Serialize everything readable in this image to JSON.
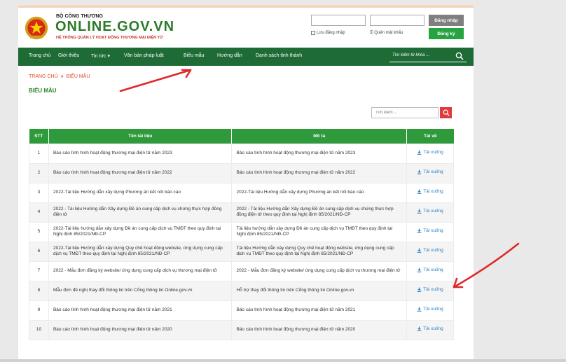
{
  "header": {
    "ministry": "BỘ CÔNG THƯƠNG",
    "brand": "ONLINE.GOV.VN",
    "subtitle": "HỆ THỐNG QUẢN LÝ HOẠT ĐỘNG THƯƠNG MẠI ĐIỆN TỬ",
    "login_button": "Đăng nhập",
    "register_button": "Đăng ký",
    "remember_label": "Lưu đăng nhập",
    "forgot_label": "Quên mật khẩu",
    "forgot_icon": "key-icon"
  },
  "nav": {
    "items": [
      "Trang chủ",
      "Giới thiệu",
      "Tin tức ▾",
      "Văn bản pháp luật",
      "Biểu mẫu",
      "Hướng dẫn",
      "Danh sách tỉnh thành"
    ],
    "search_placeholder": "Tìm kiếm từ khóa ...",
    "bg_color": "#1e6b36"
  },
  "breadcrumb": {
    "home": "TRANG CHỦ",
    "separator": "»",
    "current": "BIỂU MẪU"
  },
  "page_title": "BIỂU MẪU",
  "search": {
    "placeholder": "Tìm kiếm ..."
  },
  "table": {
    "headers": [
      "STT",
      "Tên tài liệu",
      "Mô tả",
      "Tải về"
    ],
    "download_label": "Tải xuống",
    "rows": [
      {
        "stt": "1",
        "name": "Báo cáo tình hình hoạt động thương mại điện tử năm 2023",
        "desc": "Báo cáo tình hình hoạt động thương mại điện tử năm 2023"
      },
      {
        "stt": "2",
        "name": "Báo cáo tình hình hoạt động thương mại điện tử năm 2022",
        "desc": "Báo cáo tình hình hoạt động thương mại điện tử năm 2022"
      },
      {
        "stt": "3",
        "name": "2022-Tài liệu Hướng dẫn xây dựng Phương án kết nối báo cáo",
        "desc": "2022-Tài liệu Hướng dẫn xây dựng Phương án kết nối báo cáo"
      },
      {
        "stt": "4",
        "name": "2022 - Tài liệu Hướng dẫn Xây dựng Đề án cung cấp dịch vụ chứng thực hợp đồng điện tử",
        "desc": "2022 - Tài liệu Hướng dẫn Xây dựng Đề án cung cấp dịch vụ chứng thực hợp đồng điện tử theo quy định tại Nghị định 85/2021/NĐ-CP"
      },
      {
        "stt": "5",
        "name": "2022-Tài liệu hướng dẫn xây dựng Đề án cung cấp dịch vụ TMĐT theo quy định tại Nghị định 85/2021/NĐ-CP",
        "desc": "Tài liệu hướng dẫn xây dựng Đề án cung cấp dịch vụ TMĐT theo quy định tại Nghị định 85/2021/NĐ-CP"
      },
      {
        "stt": "6",
        "name": "2022-Tài liệu Hướng dẫn xây dựng Quy chế hoạt động website, ứng dụng cung cấp dịch vụ TMĐT theo quy định tại Nghị định 85/2021/NĐ-CP",
        "desc": "Tài liệu Hướng dẫn xây dựng Quy chế hoạt động website, ứng dụng cung cấp dịch vụ TMĐT theo quy định tại Nghị định 85/2021/NĐ-CP"
      },
      {
        "stt": "7",
        "name": "2022 - Mẫu đơn đăng ký website/ ứng dụng cung cấp dịch vụ thương mại điện tử",
        "desc": "2022 - Mẫu đơn đăng ký website/ ứng dụng cung cấp dịch vụ thương mại điện tử"
      },
      {
        "stt": "8",
        "name": "Mẫu đơn đề nghị thay đổi thông tin trên Cổng thông tin Online.gov.vn",
        "desc": "Hỗ trợ thay đổi thông tin trên Cổng thông tin Online.gov.vn"
      },
      {
        "stt": "9",
        "name": "Báo cáo tình hình hoạt động thương mại điện tử năm 2021",
        "desc": "Báo cáo tình hình hoạt động thương mại điện tử năm 2021"
      },
      {
        "stt": "10",
        "name": "Báo cáo tình hình hoạt động thương mại điện tử năm 2020",
        "desc": "Báo cáo tình hình hoạt động thương mại điện tử năm 2020"
      }
    ]
  },
  "colors": {
    "accent_green": "#2e9a3b",
    "brand_green": "#2d7a2b",
    "arrow_red": "#e02828",
    "link_blue": "#2a7fc0"
  }
}
